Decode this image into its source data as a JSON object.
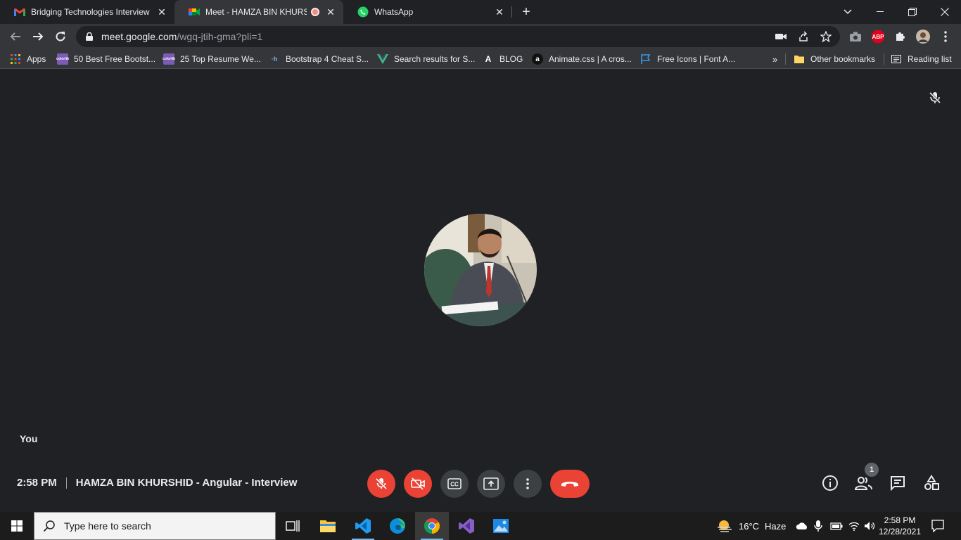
{
  "browser": {
    "tabs": [
      {
        "title": "Bridging Technologies Interview",
        "favicon": "gmail-icon"
      },
      {
        "title": "Meet - HAMZA BIN KHURSHID",
        "favicon": "meet-icon",
        "recording": true
      },
      {
        "title": "WhatsApp",
        "favicon": "whatsapp-icon"
      }
    ],
    "url_domain": "meet.google.com",
    "url_path": "/wgq-jtih-gma?pli=1",
    "extension_abp": "ABP",
    "bookmarks": [
      {
        "label": "Apps",
        "icon": "apps-grid-icon"
      },
      {
        "label": "50 Best Free Bootst...",
        "icon": "colorlib-icon",
        "icon_text": "colorlib"
      },
      {
        "label": "25 Top Resume We...",
        "icon": "colorlib-icon",
        "icon_text": "colorlib"
      },
      {
        "label": "Bootstrap 4 Cheat S...",
        "icon": "hackerthemes-icon",
        "icon_text": "·h"
      },
      {
        "label": "Search results for S...",
        "icon": "vue-icon"
      },
      {
        "label": "BLOG",
        "icon": "a-logo-icon",
        "icon_text": "A"
      },
      {
        "label": "Animate.css | A cros...",
        "icon": "animate-icon",
        "icon_text": "a"
      },
      {
        "label": "Free Icons | Font A...",
        "icon": "flag-icon"
      }
    ],
    "more_bookmarks": "»",
    "other_bookmarks": "Other bookmarks",
    "reading_list": "Reading list"
  },
  "meet": {
    "self_label": "You",
    "time": "2:58 PM",
    "meeting_title": "HAMZA BIN KHURSHID - Angular - Interview",
    "participants_count": "1"
  },
  "taskbar": {
    "search_placeholder": "Type here to search",
    "weather_temp": "16°C",
    "weather_desc": "Haze",
    "clock_time": "2:58 PM",
    "clock_date": "12/28/2021"
  },
  "colors": {
    "meet_red": "#ea4335",
    "meet_grey": "#3c4043",
    "background": "#202124"
  }
}
